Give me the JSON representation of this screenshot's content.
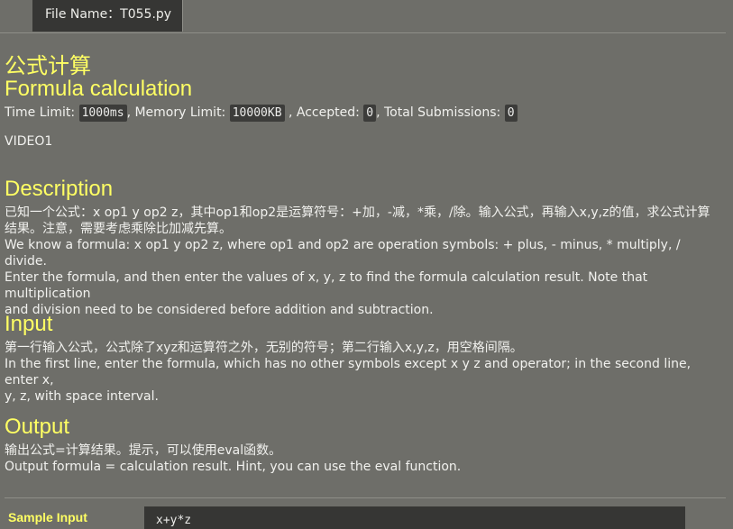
{
  "file_tab": {
    "label": "File Name：T055.py"
  },
  "problem": {
    "title_cn": "公式计算",
    "title_en": "Formula calculation",
    "time_limit_label": "Time Limit:",
    "time_limit": "1000ms",
    "memory_limit_label": ", Memory Limit:",
    "memory_limit": "10000KB",
    "accepted_label": ", Accepted:",
    "accepted": "0",
    "total_label": ", Total Submissions:",
    "total_submissions": "0",
    "video": "VIDEO1"
  },
  "sections": {
    "description": {
      "heading": "Description",
      "cn_line1": "已知一个公式：x op1 y op2 z，其中op1和op2是运算符号：+加，-减，*乘，/除。输入公式，再输入x,y,z的值，求公式计算",
      "cn_line2": "结果。注意，需要考虑乘除比加减先算。",
      "en_line1": "We know a formula: x op1 y op2 z, where op1 and op2 are operation symbols: + plus, - minus, * multiply, / divide.",
      "en_line2": "Enter the formula, and then enter the values of x, y, z to find the formula calculation result. Note that multiplication",
      "en_line3": "and division need to be considered before addition and subtraction."
    },
    "input": {
      "heading": "Input",
      "cn_line1": "第一行输入公式，公式除了xyz和运算符之外，无别的符号；第二行输入x,y,z，用空格间隔。",
      "en_line1": "In the first line, enter the formula, which has no other symbols except x y z and operator; in the second line, enter x,",
      "en_line2": "y, z, with space interval."
    },
    "output": {
      "heading": "Output",
      "cn_line1": "输出公式=计算结果。提示，可以使用eval函数。",
      "en_line1": "Output formula = calculation result. Hint, you can use the eval function."
    }
  },
  "sample": {
    "label": "Sample Input",
    "input_line1": "x+y*z"
  }
}
